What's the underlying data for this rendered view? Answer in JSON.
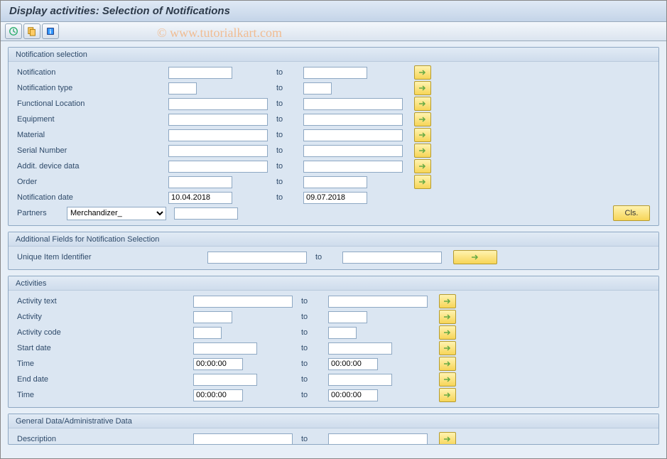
{
  "header": {
    "title": "Display activities: Selection of Notifications"
  },
  "watermark": "© www.tutorialkart.com",
  "labels": {
    "to": "to"
  },
  "groups": {
    "notif_sel": {
      "title": "Notification selection",
      "fields": {
        "notification": {
          "label": "Notification",
          "from": "",
          "to": ""
        },
        "notif_type": {
          "label": "Notification type",
          "from": "",
          "to": ""
        },
        "func_loc": {
          "label": "Functional Location",
          "from": "",
          "to": ""
        },
        "equipment": {
          "label": "Equipment",
          "from": "",
          "to": ""
        },
        "material": {
          "label": "Material",
          "from": "",
          "to": ""
        },
        "serial": {
          "label": "Serial Number",
          "from": "",
          "to": ""
        },
        "addit_dev": {
          "label": "Addit. device data",
          "from": "",
          "to": ""
        },
        "order": {
          "label": "Order",
          "from": "",
          "to": ""
        },
        "notif_date": {
          "label": "Notification date",
          "from": "10.04.2018",
          "to": "09.07.2018"
        },
        "partners": {
          "label": "Partners",
          "dropdown": "Merchandizer_",
          "value": "",
          "cls_btn": "Cls."
        }
      }
    },
    "addl": {
      "title": "Additional Fields for Notification Selection",
      "uii": {
        "label": "Unique Item Identifier",
        "from": "",
        "to": ""
      }
    },
    "activities": {
      "title": "Activities",
      "fields": {
        "act_text": {
          "label": "Activity text",
          "from": "",
          "to": ""
        },
        "activity": {
          "label": "Activity",
          "from": "",
          "to": ""
        },
        "act_code": {
          "label": "Activity code",
          "from": "",
          "to": ""
        },
        "start_date": {
          "label": "Start date",
          "from": "",
          "to": ""
        },
        "time1": {
          "label": "Time",
          "from": "00:00:00",
          "to": "00:00:00"
        },
        "end_date": {
          "label": "End date",
          "from": "",
          "to": ""
        },
        "time2": {
          "label": "Time",
          "from": "00:00:00",
          "to": "00:00:00"
        }
      }
    },
    "general": {
      "title": "General Data/Administrative Data",
      "description": {
        "label": "Description",
        "from": "",
        "to": ""
      }
    }
  }
}
